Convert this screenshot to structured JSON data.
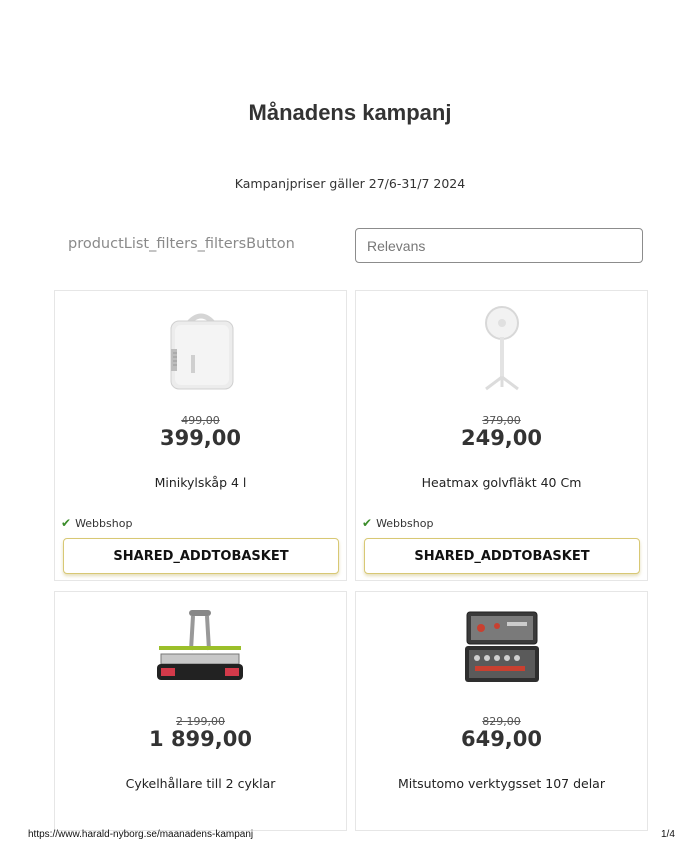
{
  "header": {
    "title": "Månadens kampanj",
    "campaign_note": "Kampanjpriser gäller 27/6-31/7 2024"
  },
  "toolbar": {
    "filters_label": "productList_filters_filtersButton",
    "sort_selected": "Relevans"
  },
  "products": [
    {
      "old_price": "499,00",
      "price": "399,00",
      "name": "Minikylskåp 4 l",
      "stock": "Webbshop",
      "add_label": "SHARED_ADDTOBASKET",
      "image_icon": "mini-fridge-icon"
    },
    {
      "old_price": "379,00",
      "price": "249,00",
      "name": "Heatmax golvfläkt 40 Cm",
      "stock": "Webbshop",
      "add_label": "SHARED_ADDTOBASKET",
      "image_icon": "floor-fan-icon"
    },
    {
      "old_price": "2 199,00",
      "price": "1 899,00",
      "name": "Cykelhållare till 2 cyklar",
      "image_icon": "bike-rack-icon"
    },
    {
      "old_price": "829,00",
      "price": "649,00",
      "name": "Mitsutomo verktygsset 107 delar",
      "image_icon": "tool-case-icon"
    }
  ],
  "footer": {
    "url": "https://www.harald-nyborg.se/maanadens-kampanj",
    "page": "1/4"
  }
}
